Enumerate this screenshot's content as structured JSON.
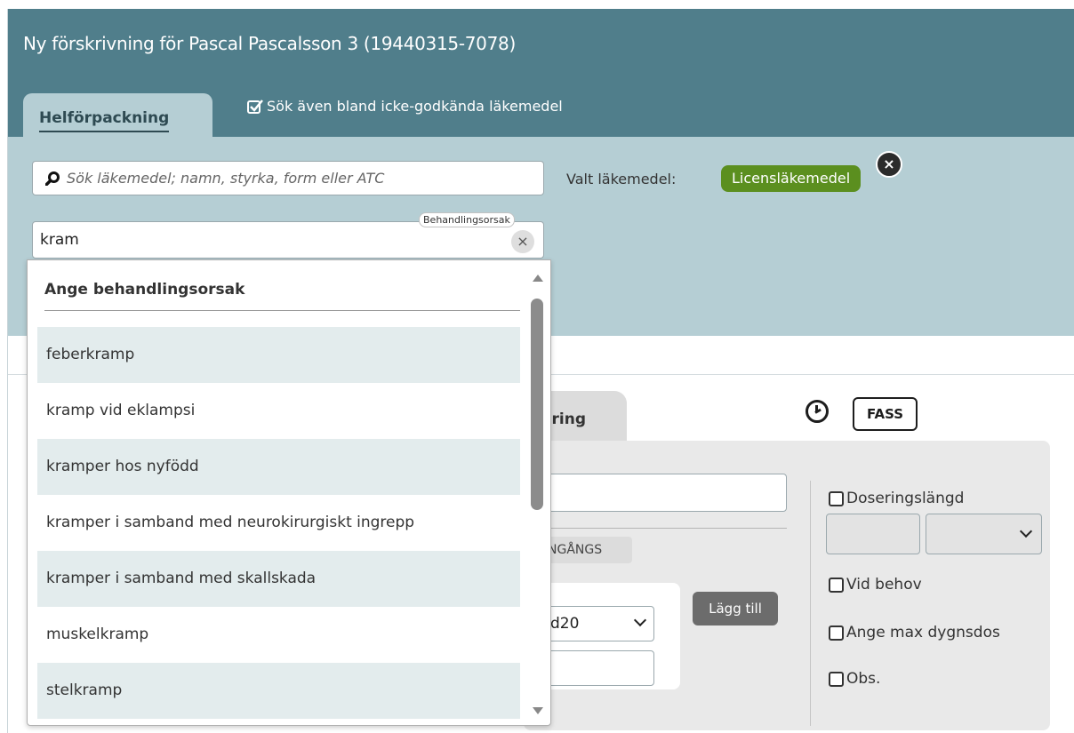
{
  "window": {
    "title": "Ny förskrivning för Pascal Pascalsson 3 (19440315-7078)"
  },
  "tabs": {
    "active_label": "Helförpackning",
    "checkbox_label": "Sök även bland icke-godkända läkemedel"
  },
  "search": {
    "placeholder": "Sök läkemedel; namn, styrka, form eller ATC",
    "selected_label": "Valt läkemedel:",
    "selected_badge": "Licensläkemedel",
    "badge_color": "#5b8f1f"
  },
  "reason": {
    "value": "kram",
    "float_label": "Behandlingsorsak"
  },
  "dropdown": {
    "header": "Ange behandlingsorsak",
    "items": [
      "feberkramp",
      "kramp vid eklampsi",
      "kramper hos nyfödd",
      "kramper i samband med neurokirurgiskt ingrepp",
      "kramper i samband med skallskada",
      "muskelkramp",
      "stelkramp"
    ]
  },
  "dosering": {
    "tab_label": "ering",
    "fass_label": "FASS",
    "ingangs_label": "NGÅNGS",
    "select_value": "d20",
    "add_button": "Lägg till",
    "checkbox_doseringslangd": "Doseringslängd",
    "checkbox_vid_behov": "Vid behov",
    "checkbox_max_dygnsdos": "Ange max dygnsdos",
    "checkbox_obs": "Obs."
  },
  "colors": {
    "header": "#507e8b",
    "panel": "#b5ced4",
    "row_alt": "#e3eced"
  }
}
